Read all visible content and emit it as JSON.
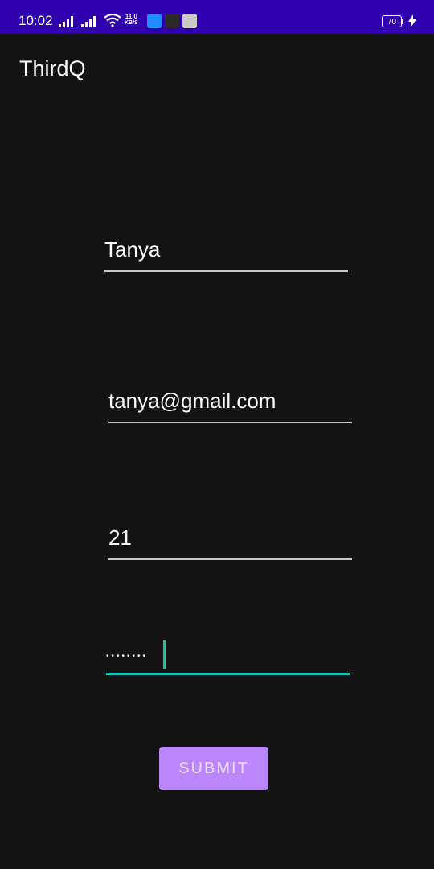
{
  "status_bar": {
    "time": "10:02",
    "net_speed_value": "11.0",
    "net_speed_unit": "KB/S",
    "battery_level": "70",
    "colors": {
      "background": "#3000b0"
    }
  },
  "app_bar": {
    "title": "ThirdQ"
  },
  "form": {
    "name_value": "Tanya",
    "email_value": "tanya@gmail.com",
    "age_value": "21",
    "password_mask": "••••••••",
    "submit_label": "SUBMIT"
  },
  "colors": {
    "background": "#131313",
    "accent": "#17c3b2",
    "button": "#bb86fc"
  }
}
